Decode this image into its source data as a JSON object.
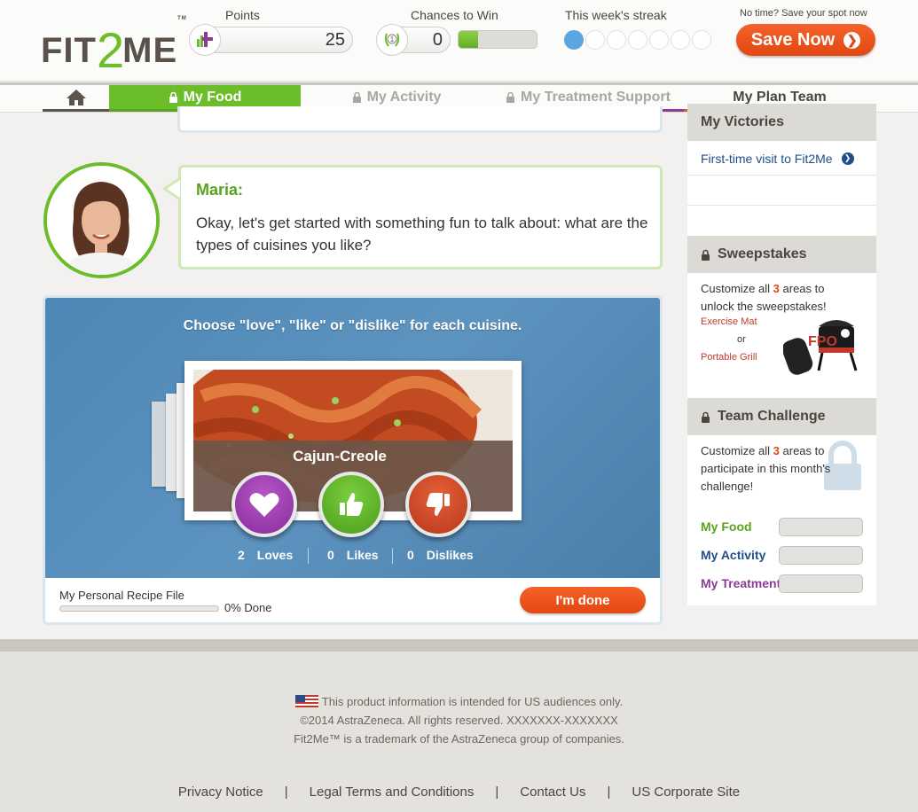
{
  "header": {
    "logo": {
      "fit": "FIT",
      "two": "2",
      "me": "ME",
      "tm": "TM"
    },
    "points_label": "Points",
    "points_value": "25",
    "chances_label": "Chances to Win",
    "chances_value": "0",
    "chances_progress": 0.25,
    "streak_label": "This week's streak",
    "streak_days": 7,
    "streak_completed": 1,
    "notime_text": "No time? Save your spot now",
    "save_button": "Save Now"
  },
  "nav": {
    "home_icon": "home-icon",
    "tabs": [
      {
        "label": "My Food",
        "locked": true,
        "active": true
      },
      {
        "label": "My Activity",
        "locked": true,
        "active": false
      },
      {
        "label": "My Treatment Support",
        "locked": true,
        "active": false
      },
      {
        "label": "My Plan Team",
        "locked": false,
        "active": false
      }
    ]
  },
  "chat": {
    "name": "Maria:",
    "message": "Okay, let's get started with something fun to talk about: what are the types of cuisines you like?"
  },
  "game": {
    "instruction": "Choose \"love\", \"like\" or \"dislike\" for each cuisine.",
    "cuisine": "Cajun-Creole",
    "loves_count": "2",
    "loves_label": "Loves",
    "likes_count": "0",
    "likes_label": "Likes",
    "dislikes_count": "0",
    "dislikes_label": "Dislikes",
    "recipe_label": "My Personal Recipe File",
    "recipe_percent": "0% Done",
    "done_button": "I'm done"
  },
  "sidebar": {
    "victories_title": "My Victories",
    "victory_link": "First-time visit to Fit2Me",
    "sweepstakes_title": "Sweepstakes",
    "sweep_text_1": "Customize all",
    "sweep_num": "3",
    "sweep_text_2": "areas to unlock the sweepstakes!",
    "prize_1": "Exercise Mat",
    "prize_or": "or",
    "prize_2": "Portable Grill",
    "team_title": "Team Challenge",
    "team_text_1": "Customize all",
    "team_num": "3",
    "team_text_2": "areas to participate in this month's challenge!",
    "team_rows": [
      {
        "label": "My Food",
        "color": "#5aa31f",
        "progress": 0
      },
      {
        "label": "My Activity",
        "color": "#1f4e89",
        "progress": 0
      },
      {
        "label": "My Treatment",
        "color": "#8c3c97",
        "progress": 0
      }
    ]
  },
  "footer": {
    "us_notice": "This product information is intended for US audiences only.",
    "copyright": "©2014 AstraZeneca. All rights reserved. XXXXXXX-XXXXXXX",
    "trademark": "Fit2Me™ is a trademark of the AstraZeneca group of companies.",
    "links": [
      "Privacy Notice",
      "Legal Terms and Conditions",
      "Contact Us",
      "US Corporate Site"
    ],
    "separator": "|"
  },
  "colors": {
    "brand_green": "#6cbd2a",
    "orange": "#e24711",
    "activity_blue": "#1f4e89",
    "treatment_purple": "#8c3c97",
    "streak_blue": "#5ba6e0"
  }
}
